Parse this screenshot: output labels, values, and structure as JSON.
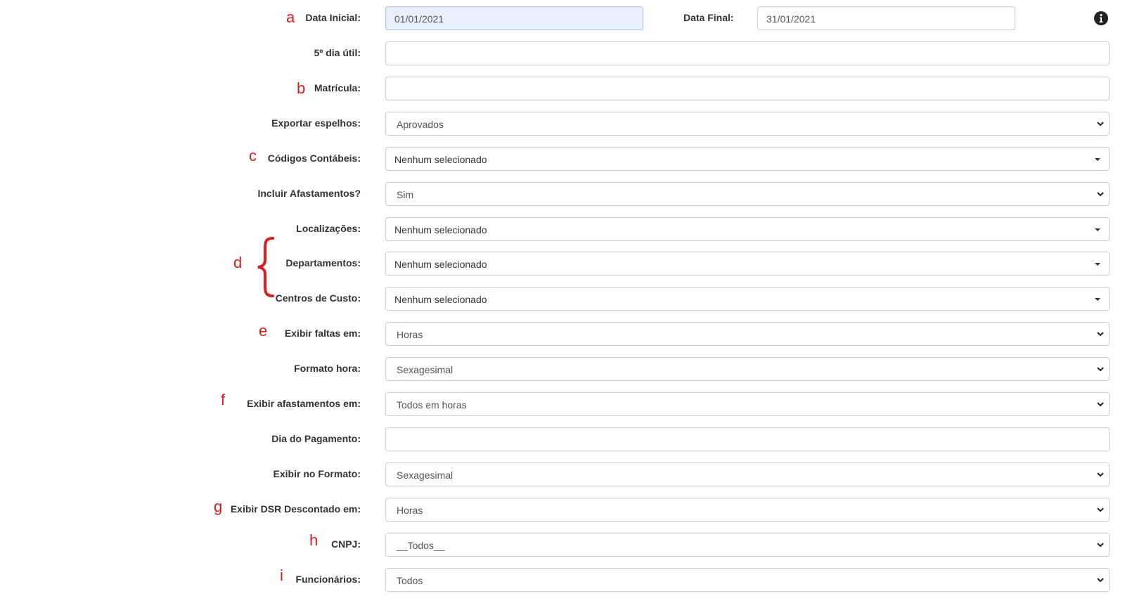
{
  "header": {
    "data_inicial_label": "Data Inicial:",
    "data_inicial_value": "01/01/2021",
    "data_final_label": "Data Final:",
    "data_final_value": "31/01/2021",
    "info_icon": "info-circle-icon"
  },
  "form": {
    "quinto_dia_label": "5º dia útil:",
    "quinto_dia_value": "",
    "matricula_label": "Matrícula:",
    "matricula_value": "",
    "exportar_espelhos_label": "Exportar espelhos:",
    "exportar_espelhos_value": "Aprovados",
    "codigos_contabeis_label": "Códigos Contábeis:",
    "codigos_contabeis_value": "Nenhum selecionado",
    "incluir_afastamentos_label": "Incluir Afastamentos?",
    "incluir_afastamentos_value": "Sim",
    "localizacoes_label": "Localizações:",
    "localizacoes_value": "Nenhum selecionado",
    "departamentos_label": "Departamentos:",
    "departamentos_value": "Nenhum selecionado",
    "centros_custo_label": "Centros de Custo:",
    "centros_custo_value": "Nenhum selecionado",
    "exibir_faltas_label": "Exibir faltas em:",
    "exibir_faltas_value": "Horas",
    "formato_hora_label": "Formato hora:",
    "formato_hora_value": "Sexagesimal",
    "exibir_afastamentos_label": "Exibir afastamentos em:",
    "exibir_afastamentos_value": "Todos em horas",
    "dia_pagamento_label": "Dia do Pagamento:",
    "dia_pagamento_value": "",
    "exibir_formato_label": "Exibir no Formato:",
    "exibir_formato_value": "Sexagesimal",
    "exibir_dsr_label": "Exibir DSR Descontado em:",
    "exibir_dsr_value": "Horas",
    "cnpj_label": "CNPJ:",
    "cnpj_value": "__Todos__",
    "funcionarios_label": "Funcionários:",
    "funcionarios_value": "Todos"
  },
  "annotations": {
    "a": "a",
    "b": "b",
    "c": "c",
    "d": "d",
    "e": "e",
    "f": "f",
    "g": "g",
    "h": "h",
    "i": "i",
    "color": "#e01b1b"
  },
  "colors": {
    "active_field_bg": "#e8f0fe",
    "border": "#cccccc",
    "label": "#333333"
  }
}
